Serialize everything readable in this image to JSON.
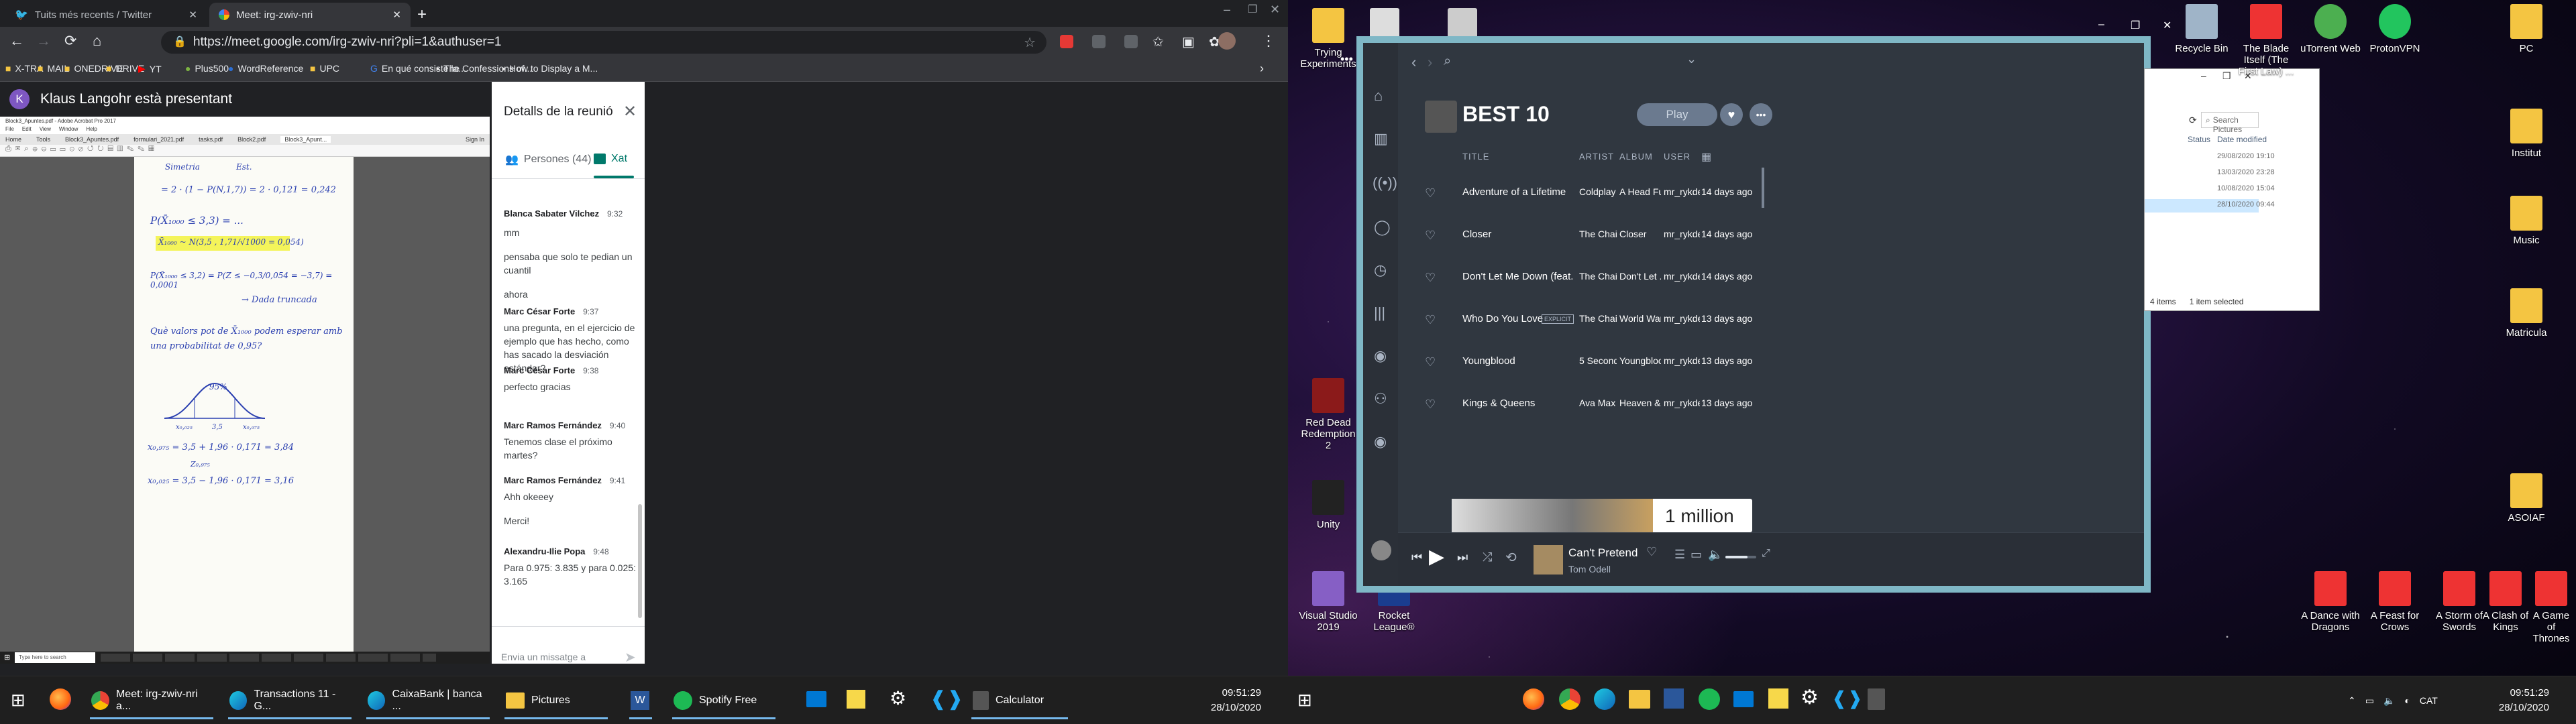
{
  "left": {
    "tabs": [
      {
        "label": "Tuits més recents / Twitter"
      },
      {
        "label": "Meet: irg-zwiv-nri"
      }
    ],
    "url": "https://meet.google.com/irg-zwiv-nri?pli=1&authuser=1",
    "bookmarks": [
      "X-TRA",
      "MAIL",
      "ONEDRIVE",
      "DRIVE",
      "YT",
      "Plus500",
      "WordReference",
      "UPC",
      "En qué consiste la...",
      "The Confessions of...",
      "How to Display a M..."
    ],
    "meet": {
      "avatar_letter": "K",
      "presenter": "Klaus Langohr està presentant",
      "panel_title": "Detalls de la reunió",
      "people_tab": "Persones (44)",
      "chat_tab": "Xat",
      "messages": [
        {
          "author": "Blanca Sabater Vilchez",
          "time": "9:32",
          "lines": [
            "mm",
            "pensaba que solo te pedian un cuantil",
            "ahora"
          ]
        },
        {
          "author": "Marc César Forte",
          "time": "9:37",
          "lines": [
            "una pregunta, en el ejercicio de ejemplo que has hecho, como has sacado la desviación estándar?"
          ]
        },
        {
          "author": "Marc César Forte",
          "time": "9:38",
          "lines": [
            "perfecto gracias"
          ]
        },
        {
          "author": "Marc Ramos Fernández",
          "time": "9:40",
          "lines": [
            "Tenemos clase el próximo martes?"
          ]
        },
        {
          "author": "Marc Ramos Fernández",
          "time": "9:41",
          "lines": [
            "Ahh okeeey",
            "Merci!"
          ]
        },
        {
          "author": "Alexandru-Ilie Popa",
          "time": "9:48",
          "lines": [
            "Para 0.975: 3.835 y para 0.025: 3.165"
          ]
        }
      ],
      "input_placeholder": "Envia un missatge a tothom"
    },
    "pdf": {
      "title": "Block3_Apuntes.pdf - Adobe Acrobat Pro 2017",
      "menu": [
        "File",
        "Edit",
        "View",
        "Window",
        "Help"
      ],
      "tabs": [
        "Home",
        "Tools",
        "Block3_Apuntes.pdf",
        "formulari_2021.pdf",
        "tasks.pdf",
        "Block2.pdf",
        "Block3_Apunt..."
      ],
      "signin": "Sign In",
      "notes": [
        "Simetria",
        "Est.",
        "= 2 · (1 − P(N,1,7)) = 2 · 0,121 = 0,242",
        "P(X̄₁₀₀₀ ≤ 3,3) = ...",
        "X̄₁₀₀₀ ~ N(3,5 , 1,71/√1000 = 0,054)",
        "P(X̄₁₀₀₀ ≤ 3,2) = P(Z ≤ −0,3/0,054 = −3,7) = 0,0001",
        "→ Dada truncada",
        "Què valors pot de X̄₁₀₀₀ podem esperar amb una probabilitat de 0,95?",
        "95%",
        "x₀,₀₂₅",
        "3,5",
        "x₀,₉₇₅",
        "x₀,₉₇₅ = 3,5 + 1,96 · 0,171 = 3,84",
        "Z₀,₉₇₅",
        "x₀,₀₂₅ = 3,5 − 1,96 · 0,171 = 3,16"
      ]
    },
    "inner_taskbar_search": "Type here to search",
    "taskbar": [
      {
        "label": "Meet: irg-zwiv-nri a..."
      },
      {
        "label": "Transactions 11 - G..."
      },
      {
        "label": "CaixaBank | banca ..."
      },
      {
        "label": "Pictures"
      },
      {
        "label": ""
      },
      {
        "label": "Spotify Free"
      },
      {
        "label": ""
      },
      {
        "label": ""
      },
      {
        "label": ""
      },
      {
        "label": "Calculator"
      }
    ],
    "clock": {
      "time": "09:51:29",
      "date": "28/10/2020"
    }
  },
  "right": {
    "desktop_icons_left": [
      {
        "label": "Trying Experiments"
      },
      {
        "label": "Red Dead Redemption 2"
      },
      {
        "label": "Unity"
      },
      {
        "label": "Visual Studio 2019"
      },
      {
        "label": "Rocket League®"
      }
    ],
    "desktop_icons_top": [
      {
        "label": "Recycle Bin"
      },
      {
        "label": "The Blade Itself (The First Law) ..."
      },
      {
        "label": "uTorrent Web"
      },
      {
        "label": "ProtonVPN"
      },
      {
        "label": "PC"
      }
    ],
    "desktop_icons_right": [
      {
        "label": "Institut"
      },
      {
        "label": "Music"
      },
      {
        "label": "Matricula"
      },
      {
        "label": "ASOIAF"
      }
    ],
    "desktop_icons_bottom": [
      {
        "label": "A Dance with Dragons"
      },
      {
        "label": "A Feast for Crows"
      },
      {
        "label": "A Storm of Swords"
      },
      {
        "label": "A Clash of Kings"
      },
      {
        "label": "A Game of Thrones"
      }
    ],
    "explorer": {
      "search_placeholder": "Search Pictures",
      "columns": [
        "Status",
        "Date modified"
      ],
      "dates": [
        "29/08/2020 19:10",
        "13/03/2020 23:28",
        "10/08/2020 15:04",
        "28/10/2020 09:44"
      ],
      "status_items": "4 items",
      "status_selected": "1 item selected"
    },
    "spotify": {
      "playlist_title": "BEST 10",
      "play_label": "Play",
      "headers": {
        "title": "TITLE",
        "artist": "ARTIST",
        "album": "ALBUM",
        "user": "USER"
      },
      "tracks": [
        {
          "title": "Adventure of a Lifetime",
          "explicit": "",
          "artist": "Coldplay",
          "album": "A Head Ful...",
          "user": "mr_rykdel",
          "added": "14 days ago"
        },
        {
          "title": "Closer",
          "explicit": "",
          "artist": "The Chain...",
          "album": "Closer",
          "user": "mr_rykdel",
          "added": "14 days ago"
        },
        {
          "title": "Don't Let Me Down (feat. Daya)",
          "explicit": "",
          "artist": "The Chain...",
          "album": "Don't Let ...",
          "user": "mr_rykdel",
          "added": "14 days ago"
        },
        {
          "title": "Who Do You Love",
          "explicit": "EXPLICIT",
          "artist": "The Chain...",
          "album": "World War ...",
          "user": "mr_rykdel",
          "added": "13 days ago"
        },
        {
          "title": "Youngblood",
          "explicit": "",
          "artist": "5 Seconds...",
          "album": "Youngbloo...",
          "user": "mr_rykdel",
          "added": "13 days ago"
        },
        {
          "title": "Kings & Queens",
          "explicit": "",
          "artist": "Ava Max",
          "album": "Heaven & ...",
          "user": "mr_rykdel",
          "added": "13 days ago"
        }
      ],
      "banner_text": "1 million",
      "now_playing": {
        "title": "Can't Pretend",
        "artist": "Tom Odell"
      },
      "volume": 0.72
    },
    "tray": {
      "lang": "CAT",
      "time": "09:51:29",
      "date": "28/10/2020"
    }
  }
}
